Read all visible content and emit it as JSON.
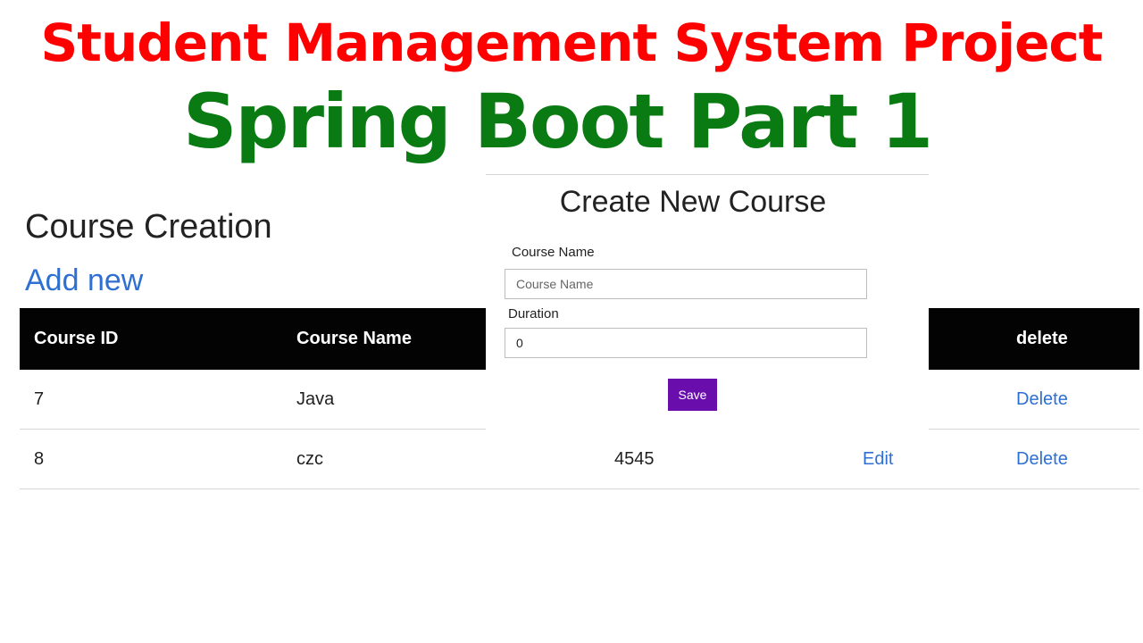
{
  "banner": {
    "title_line1": "Student Management System Project",
    "title_line2": "Spring Boot Part 1"
  },
  "page": {
    "heading": "Course Creation",
    "add_new_label": "Add new"
  },
  "table": {
    "headers": [
      "Course ID",
      "Course Name",
      "",
      "",
      "delete"
    ],
    "rows": [
      {
        "id": "7",
        "name": "Java",
        "duration": "",
        "edit": "",
        "delete": "Delete"
      },
      {
        "id": "8",
        "name": "czc",
        "duration": "4545",
        "edit": "Edit",
        "delete": "Delete"
      }
    ]
  },
  "modal": {
    "title": "Create New Course",
    "course_name_label": "Course Name",
    "course_name_placeholder": "Course Name",
    "course_name_value": "",
    "duration_label": "Duration",
    "duration_value": "0",
    "save_label": "Save"
  },
  "colors": {
    "title_red": "#ff0000",
    "title_green": "#0a7a12",
    "link_blue": "#2f6fd1",
    "header_black": "#030303",
    "save_purple": "#6a0dad"
  }
}
